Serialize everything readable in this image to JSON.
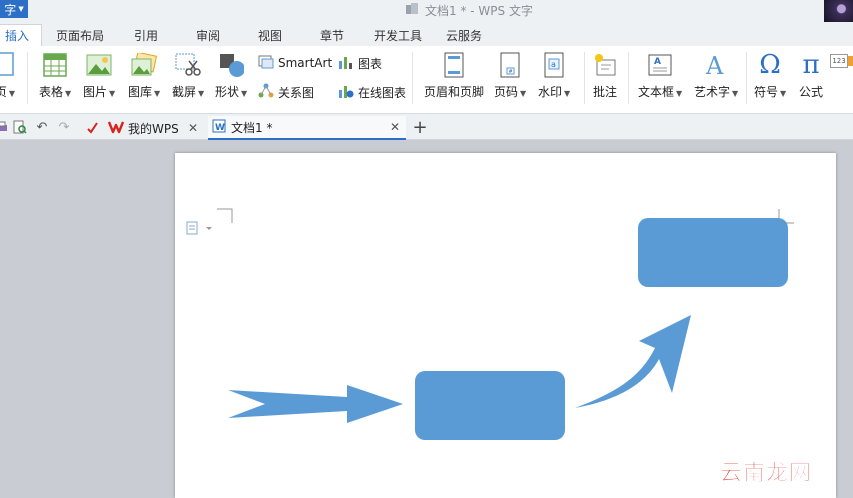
{
  "titlebar": {
    "app_menu_label": "字",
    "window_title": "文档1 * - WPS 文字"
  },
  "ribbon_tabs": [
    {
      "label": "插入",
      "active": true
    },
    {
      "label": "页面布局"
    },
    {
      "label": "引用"
    },
    {
      "label": "审阅"
    },
    {
      "label": "视图"
    },
    {
      "label": "章节"
    },
    {
      "label": "开发工具"
    },
    {
      "label": "云服务"
    }
  ],
  "ribbon": {
    "page": "页",
    "table": "表格",
    "picture": "图片",
    "gallery": "图库",
    "screenshot": "截屏",
    "shapes": "形状",
    "smartart": "SmartArt",
    "chart": "图表",
    "relation": "关系图",
    "online_chart": "在线图表",
    "header_footer": "页眉和页脚",
    "page_number": "页码",
    "watermark": "水印",
    "comment": "批注",
    "textbox": "文本框",
    "wordart": "艺术字",
    "symbol": "符号",
    "formula": "公式",
    "number_badge": "123"
  },
  "doc_tabs": [
    {
      "label": "我的WPS",
      "active": false
    },
    {
      "label": "文档1 *",
      "active": true
    }
  ],
  "colors": {
    "accent": "#2b6fc6",
    "shape_fill": "#5b9bd5",
    "wps_red": "#d9241b"
  },
  "watermark_text": "云南龙网"
}
